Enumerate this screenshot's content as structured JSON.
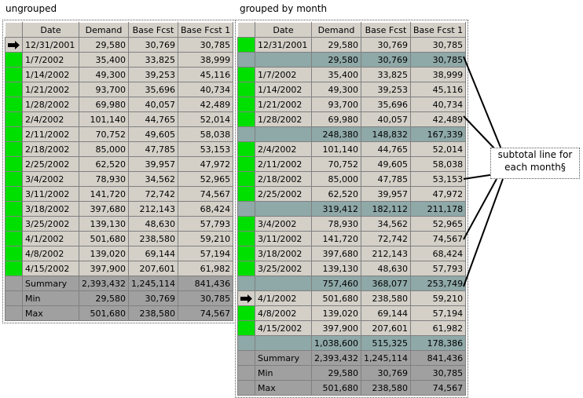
{
  "left": {
    "caption": "ungrouped",
    "headers": [
      "Date",
      "Demand",
      "Base Fcst",
      "Base Fcst 1"
    ],
    "rows": [
      {
        "ind": "arrow",
        "date": "12/31/2001",
        "demand": "29,580",
        "fcst": "30,769",
        "fcst1": "30,785"
      },
      {
        "ind": "green",
        "date": "1/7/2002",
        "demand": "35,400",
        "fcst": "33,825",
        "fcst1": "38,999"
      },
      {
        "ind": "green",
        "date": "1/14/2002",
        "demand": "49,300",
        "fcst": "39,253",
        "fcst1": "45,116"
      },
      {
        "ind": "green",
        "date": "1/21/2002",
        "demand": "93,700",
        "fcst": "35,696",
        "fcst1": "40,734"
      },
      {
        "ind": "green",
        "date": "1/28/2002",
        "demand": "69,980",
        "fcst": "40,057",
        "fcst1": "42,489"
      },
      {
        "ind": "green",
        "date": "2/4/2002",
        "demand": "101,140",
        "fcst": "44,765",
        "fcst1": "52,014"
      },
      {
        "ind": "green",
        "date": "2/11/2002",
        "demand": "70,752",
        "fcst": "49,605",
        "fcst1": "58,038"
      },
      {
        "ind": "green",
        "date": "2/18/2002",
        "demand": "85,000",
        "fcst": "47,785",
        "fcst1": "53,153"
      },
      {
        "ind": "green",
        "date": "2/25/2002",
        "demand": "62,520",
        "fcst": "39,957",
        "fcst1": "47,972"
      },
      {
        "ind": "green",
        "date": "3/4/2002",
        "demand": "78,930",
        "fcst": "34,562",
        "fcst1": "52,965"
      },
      {
        "ind": "green",
        "date": "3/11/2002",
        "demand": "141,720",
        "fcst": "72,742",
        "fcst1": "74,567"
      },
      {
        "ind": "green",
        "date": "3/18/2002",
        "demand": "397,680",
        "fcst": "212,143",
        "fcst1": "68,424"
      },
      {
        "ind": "green",
        "date": "3/25/2002",
        "demand": "139,130",
        "fcst": "48,630",
        "fcst1": "57,793"
      },
      {
        "ind": "green",
        "date": "4/1/2002",
        "demand": "501,680",
        "fcst": "238,580",
        "fcst1": "59,210"
      },
      {
        "ind": "green",
        "date": "4/8/2002",
        "demand": "139,020",
        "fcst": "69,144",
        "fcst1": "57,194"
      },
      {
        "ind": "green",
        "date": "4/15/2002",
        "demand": "397,900",
        "fcst": "207,601",
        "fcst1": "61,982"
      },
      {
        "ind": "summary",
        "date": "Summary",
        "demand": "2,393,432",
        "fcst": "1,245,114",
        "fcst1": "841,436"
      },
      {
        "ind": "summary",
        "date": "Min",
        "demand": "29,580",
        "fcst": "30,769",
        "fcst1": "30,785"
      },
      {
        "ind": "summary",
        "date": "Max",
        "demand": "501,680",
        "fcst": "238,580",
        "fcst1": "74,567"
      }
    ]
  },
  "right": {
    "caption": "grouped by month",
    "headers": [
      "Date",
      "Demand",
      "Base Fcst",
      "Base Fcst 1"
    ],
    "rows": [
      {
        "ind": "green",
        "date": "12/31/2001",
        "demand": "29,580",
        "fcst": "30,769",
        "fcst1": "30,785"
      },
      {
        "ind": "subtotal",
        "date": "",
        "demand": "29,580",
        "fcst": "30,769",
        "fcst1": "30,785"
      },
      {
        "ind": "green",
        "date": "1/7/2002",
        "demand": "35,400",
        "fcst": "33,825",
        "fcst1": "38,999"
      },
      {
        "ind": "green",
        "date": "1/14/2002",
        "demand": "49,300",
        "fcst": "39,253",
        "fcst1": "45,116"
      },
      {
        "ind": "green",
        "date": "1/21/2002",
        "demand": "93,700",
        "fcst": "35,696",
        "fcst1": "40,734"
      },
      {
        "ind": "green",
        "date": "1/28/2002",
        "demand": "69,980",
        "fcst": "40,057",
        "fcst1": "42,489"
      },
      {
        "ind": "subtotal",
        "date": "",
        "demand": "248,380",
        "fcst": "148,832",
        "fcst1": "167,339"
      },
      {
        "ind": "green",
        "date": "2/4/2002",
        "demand": "101,140",
        "fcst": "44,765",
        "fcst1": "52,014"
      },
      {
        "ind": "green",
        "date": "2/11/2002",
        "demand": "70,752",
        "fcst": "49,605",
        "fcst1": "58,038"
      },
      {
        "ind": "green",
        "date": "2/18/2002",
        "demand": "85,000",
        "fcst": "47,785",
        "fcst1": "53,153"
      },
      {
        "ind": "green",
        "date": "2/25/2002",
        "demand": "62,520",
        "fcst": "39,957",
        "fcst1": "47,972"
      },
      {
        "ind": "subtotal",
        "date": "",
        "demand": "319,412",
        "fcst": "182,112",
        "fcst1": "211,178"
      },
      {
        "ind": "green",
        "date": "3/4/2002",
        "demand": "78,930",
        "fcst": "34,562",
        "fcst1": "52,965"
      },
      {
        "ind": "green",
        "date": "3/11/2002",
        "demand": "141,720",
        "fcst": "72,742",
        "fcst1": "74,567"
      },
      {
        "ind": "green",
        "date": "3/18/2002",
        "demand": "397,680",
        "fcst": "212,143",
        "fcst1": "68,424"
      },
      {
        "ind": "green",
        "date": "3/25/2002",
        "demand": "139,130",
        "fcst": "48,630",
        "fcst1": "57,793"
      },
      {
        "ind": "subtotal",
        "date": "",
        "demand": "757,460",
        "fcst": "368,077",
        "fcst1": "253,749"
      },
      {
        "ind": "arrow",
        "date": "4/1/2002",
        "demand": "501,680",
        "fcst": "238,580",
        "fcst1": "59,210"
      },
      {
        "ind": "green",
        "date": "4/8/2002",
        "demand": "139,020",
        "fcst": "69,144",
        "fcst1": "57,194"
      },
      {
        "ind": "green",
        "date": "4/15/2002",
        "demand": "397,900",
        "fcst": "207,601",
        "fcst1": "61,982"
      },
      {
        "ind": "subtotal",
        "date": "",
        "demand": "1,038,600",
        "fcst": "515,325",
        "fcst1": "178,386"
      },
      {
        "ind": "summary",
        "date": "Summary",
        "demand": "2,393,432",
        "fcst": "1,245,114",
        "fcst1": "841,436"
      },
      {
        "ind": "summary",
        "date": "Min",
        "demand": "29,580",
        "fcst": "30,769",
        "fcst1": "30,785"
      },
      {
        "ind": "summary",
        "date": "Max",
        "demand": "501,680",
        "fcst": "238,580",
        "fcst1": "74,567"
      }
    ]
  },
  "annotation": {
    "line1": "subtotal line for",
    "line2": "each month§"
  },
  "colors": {
    "indicator_green": "#00e000",
    "subtotal_bg": "#8fa8a8",
    "summary_bg": "#a0a0a0",
    "grid_bg": "#d4d0c8"
  }
}
